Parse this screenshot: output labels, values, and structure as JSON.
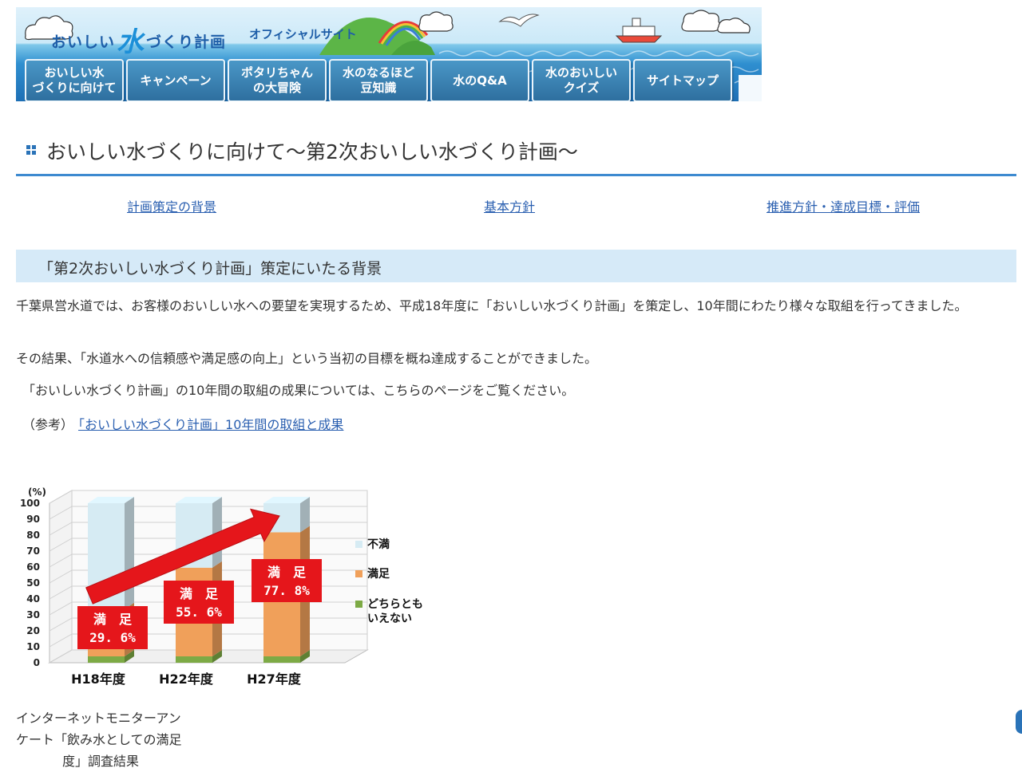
{
  "site": {
    "logo_text_1": "おいしい",
    "logo_text_big": "水",
    "logo_text_2": "づくり計画",
    "subtitle": "オフィシャルサイト"
  },
  "nav": {
    "items": [
      {
        "label": "おいしい水\nづくりに向けて"
      },
      {
        "label": "キャンペーン"
      },
      {
        "label": "ポタリちゃん\nの大冒険"
      },
      {
        "label": "水のなるほど\n豆知識"
      },
      {
        "label": "水のQ&A"
      },
      {
        "label": "水のおいしい\nクイズ"
      },
      {
        "label": "サイトマップ"
      }
    ]
  },
  "page": {
    "title": "おいしい水づくりに向けて〜第2次おいしい水づくり計画〜",
    "sublinks": [
      "計画策定の背景",
      "基本方針",
      "推進方針・達成目標・評価"
    ],
    "section_title": "「第2次おいしい水づくり計画」策定にいたる背景",
    "paragraph_1": "千葉県営水道では、お客様のおいしい水への要望を実現するため、平成18年度に「おいしい水づくり計画」を策定し、10年間にわたり様々な取組を行ってきました。",
    "paragraph_2": "その結果、「水道水への信頼感や満足感の向上」という当初の目標を概ね達成することができました。",
    "paragraph_3": "「おいしい水づくり計画」の10年間の取組の成果については、こちらのページをご覧ください。",
    "ref_label": "（参考）",
    "ref_link": "「おいしい水づくり計画」10年間の取組と成果",
    "caption_lines": [
      "インターネットモニターアン",
      "ケート「飲み水としての満足",
      "度」調査結果"
    ]
  },
  "chart_data": {
    "type": "bar",
    "stacked": true,
    "categories": [
      "H18年度",
      "H22年度",
      "H27年度"
    ],
    "series": [
      {
        "name": "どちらともいえない",
        "color": "#7daa45",
        "values": [
          4,
          4,
          4
        ]
      },
      {
        "name": "満足",
        "color": "#f0a05a",
        "values": [
          29.6,
          55.6,
          77.8
        ]
      },
      {
        "name": "不満",
        "color": "#d6ebf3",
        "values": [
          66.4,
          40.4,
          18.2
        ]
      }
    ],
    "legend": [
      "不満",
      "満足",
      "どちらとも\nいえない"
    ],
    "legend_position": "right",
    "ylabel": "(%)",
    "ylim": [
      0,
      100
    ],
    "yticks": [
      "0",
      "10",
      "20",
      "30",
      "40",
      "50",
      "60",
      "70",
      "80",
      "90",
      "100"
    ],
    "annotations": [
      {
        "category": "H18年度",
        "label": "満　足",
        "value": "29. 6%"
      },
      {
        "category": "H22年度",
        "label": "満　足",
        "value": "55. 6%"
      },
      {
        "category": "H27年度",
        "label": "満　足",
        "value": "77. 8%"
      }
    ],
    "arrow": "trend-up"
  }
}
